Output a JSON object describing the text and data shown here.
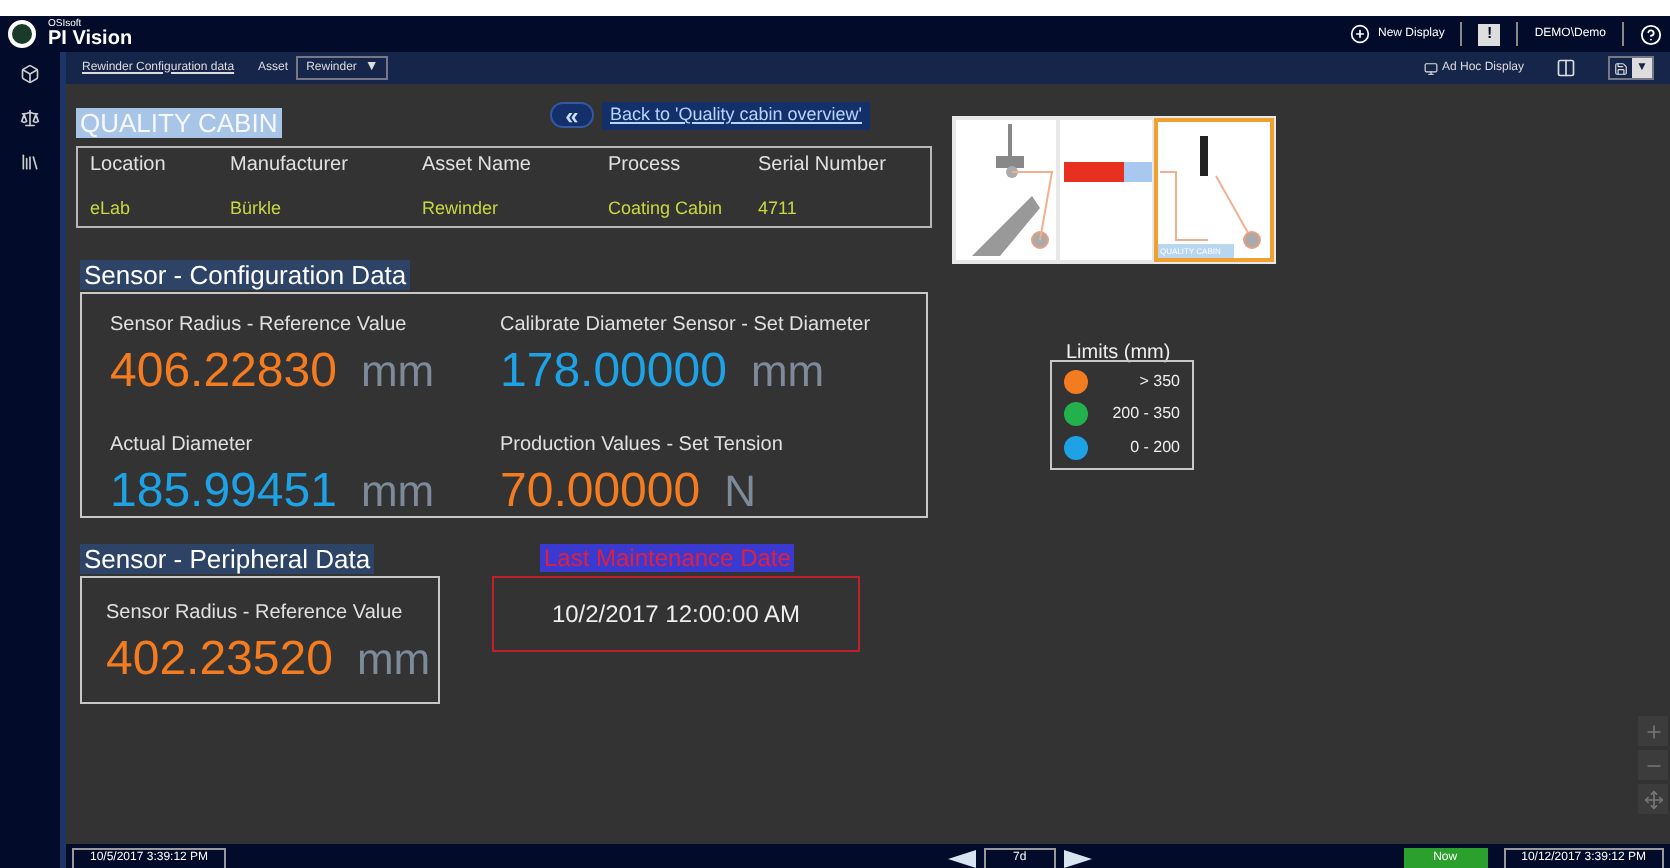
{
  "header": {
    "brand_small": "OSIsoft",
    "brand": "PI Vision",
    "new_display": "New Display",
    "alert_key": "!",
    "user": "DEMO\\Demo"
  },
  "toolbar": {
    "display_link": "Rewinder Configuration data",
    "asset_label": "Asset",
    "asset_value": "Rewinder",
    "asset_caret": "▼",
    "ad_hoc": "Ad Hoc Display",
    "save_caret": "▼"
  },
  "cabin": {
    "title": "QUALITY CABIN",
    "back_glyph": "«",
    "back_link": "Back to 'Quality cabin overview'",
    "columns": [
      {
        "header": "Location",
        "value": "eLab"
      },
      {
        "header": "Manufacturer",
        "value": "Bürkle"
      },
      {
        "header": "Asset Name",
        "value": "Rewinder"
      },
      {
        "header": "Process",
        "value": "Coating Cabin"
      },
      {
        "header": "Serial Number",
        "value": "4711"
      }
    ]
  },
  "diagram": {
    "label": "QUALITY CABIN"
  },
  "configuration": {
    "title": "Sensor - Configuration Data",
    "values": [
      {
        "label": "Sensor Radius - Reference Value",
        "value": "406.22830",
        "unit": "mm",
        "color": "#f47c20"
      },
      {
        "label": "Calibrate Diameter Sensor - Set Diameter",
        "value": "178.00000",
        "unit": "mm",
        "color": "#1ea2e6"
      },
      {
        "label": "Actual Diameter",
        "value": "185.99451",
        "unit": "mm",
        "color": "#1ea2e6"
      },
      {
        "label": "Production Values - Set Tension",
        "value": "70.00000",
        "unit": "N",
        "color": "#f47c20"
      }
    ]
  },
  "limits": {
    "title": "Limits (mm)",
    "items": [
      {
        "range": "> 350",
        "color": "#f47c20"
      },
      {
        "range": "200 - 350",
        "color": "#22b14c"
      },
      {
        "range": "0 - 200",
        "color": "#1ea2e6"
      }
    ]
  },
  "peripheral": {
    "title": "Sensor - Peripheral Data",
    "label": "Sensor Radius - Reference Value",
    "value": "402.23520",
    "unit": "mm",
    "color": "#f47c20"
  },
  "maintenance": {
    "title": "Last Maintenance Date",
    "value": "10/2/2017 12:00:00 AM"
  },
  "time_bar": {
    "start": "10/5/2017 3:39:12 PM",
    "duration": "7d",
    "now": "Now",
    "end": "10/12/2017 3:39:12 PM"
  }
}
